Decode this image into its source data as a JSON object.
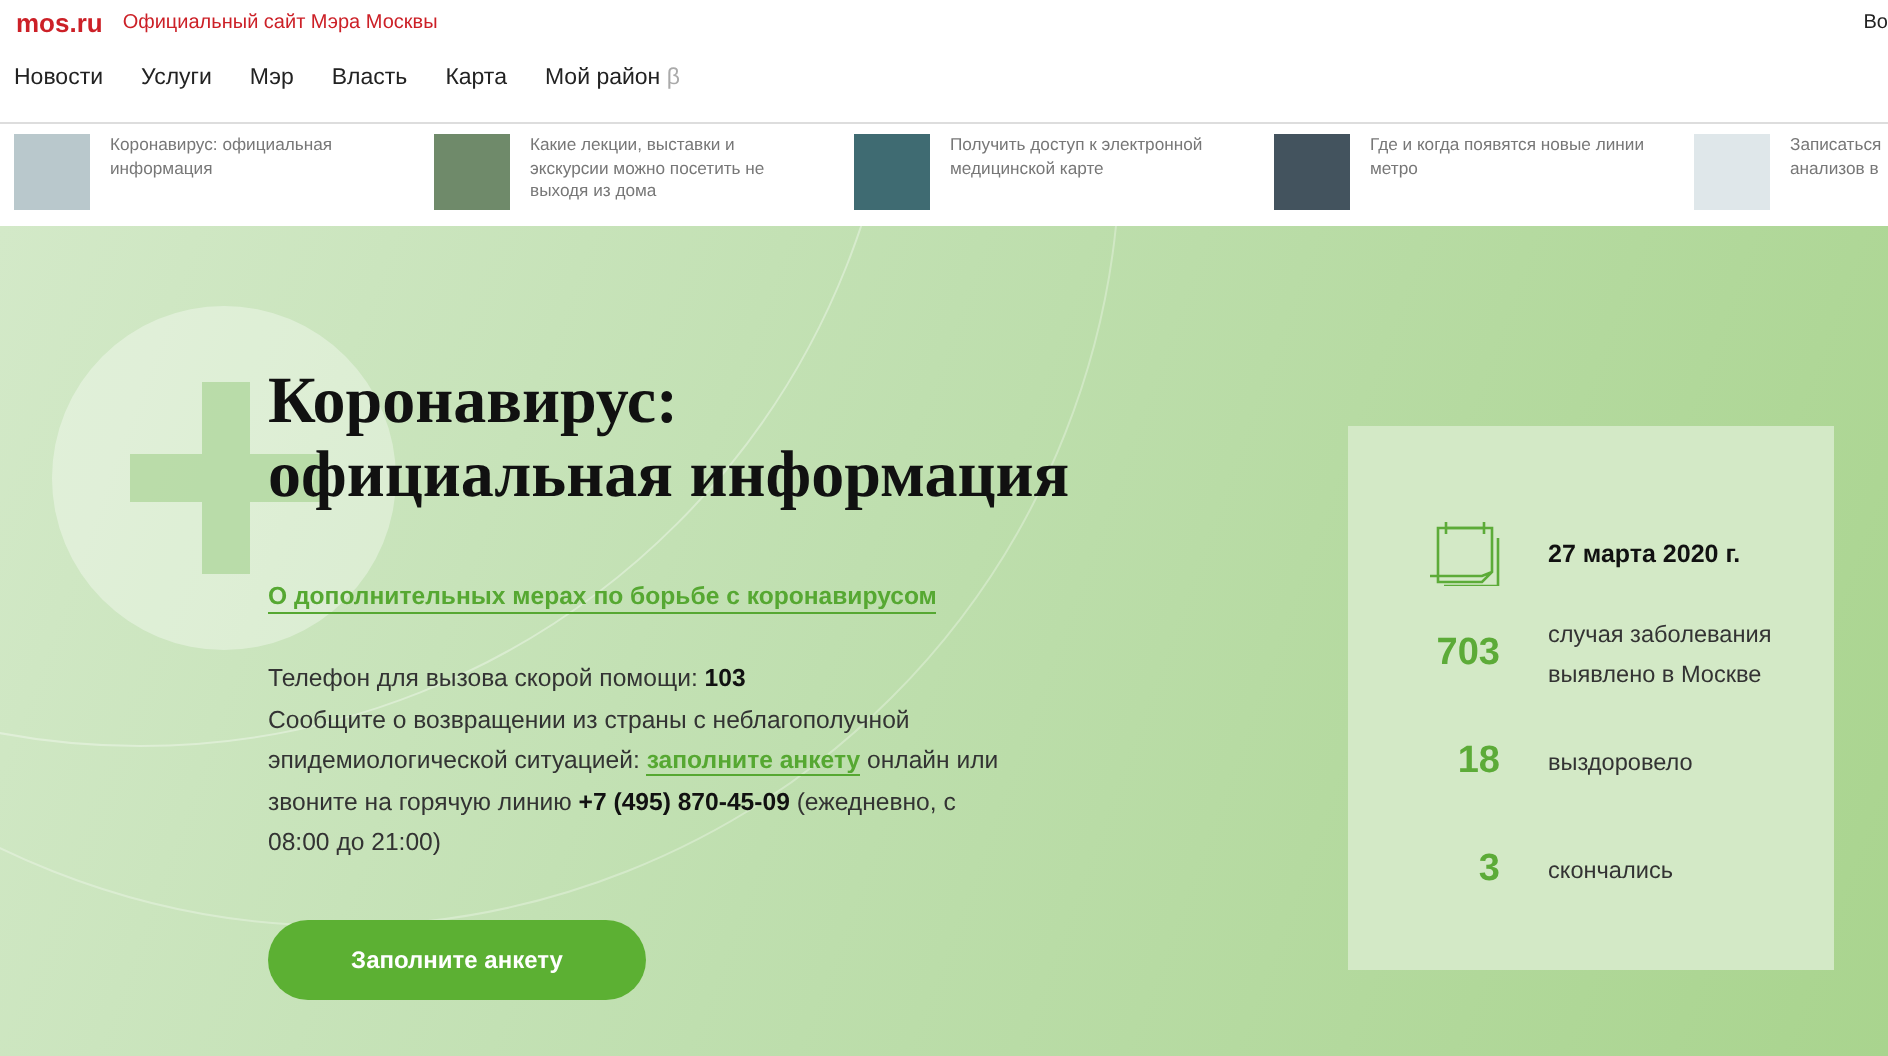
{
  "header": {
    "logo": "mos.ru",
    "subtitle": "Официальный сайт Мэра Москвы",
    "right_text": "Во"
  },
  "nav": [
    "Новости",
    "Услуги",
    "Мэр",
    "Власть",
    "Карта",
    "Мой район"
  ],
  "nav_badge": "β",
  "news": [
    {
      "text": "Коронавирус: официальная информация"
    },
    {
      "text": "Какие лекции, выставки и экскурсии можно посетить не выходя из дома"
    },
    {
      "text": "Получить доступ к электронной медицинской карте"
    },
    {
      "text": "Где и когда появятся новые линии метро"
    },
    {
      "text": "Записаться анализов в"
    }
  ],
  "hero": {
    "title_lines": [
      "Коронавирус:",
      "официальная информация"
    ],
    "measures_link": "О дополнительных мерах по борьбе с коронавирусом",
    "phone_line": "Телефон для вызова скорой помощи: **103**",
    "report_before": "Сообщите о возвращении из страны с неблагополучной эпидемиологической ситуацией:",
    "report_link": "заполните анкету",
    "report_after": "онлайн или звоните на горячую линию **+7 (495) 870-45-09** (ежедневно, с 08:00 до 21:00)",
    "button": "Заполните анкету"
  },
  "stats": {
    "date": "27 марта 2020 г.",
    "rows": [
      {
        "number": "703",
        "label": "случая заболевания выявлено в Москве"
      },
      {
        "number": "18",
        "label": "выздоровело"
      },
      {
        "number": "3",
        "label": "скончались"
      }
    ]
  }
}
